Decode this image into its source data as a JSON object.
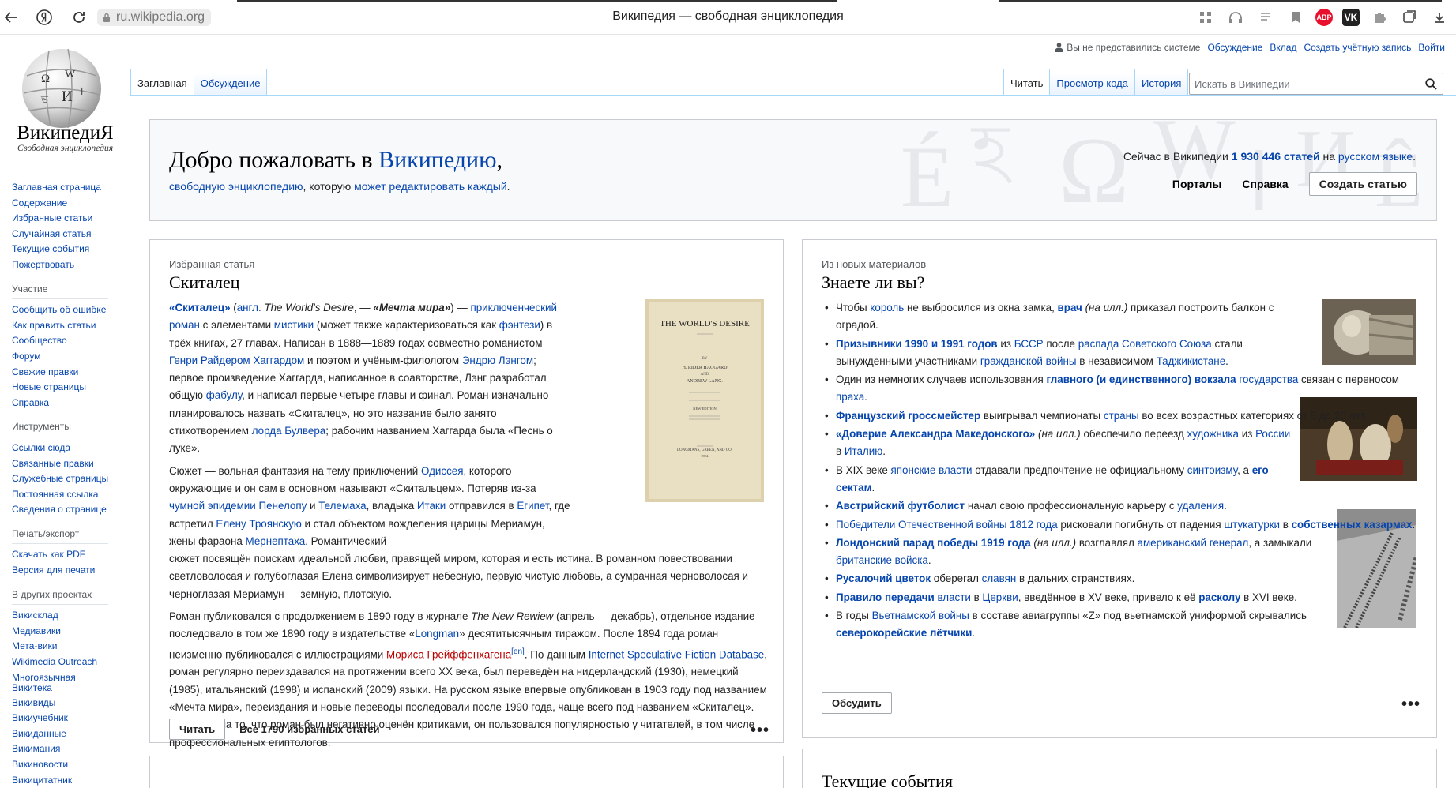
{
  "browser": {
    "url": "ru.wikipedia.org",
    "tab_title": "Википедия — свободная энциклопедия",
    "ext_abp": "ABP",
    "ext_vk": "VK"
  },
  "logo": {
    "wordmark": "ВикипедиЯ",
    "tagline": "Свободная энциклопедия"
  },
  "sidebar": {
    "main": [
      "Заглавная страница",
      "Содержание",
      "Избранные статьи",
      "Случайная статья",
      "Текущие события",
      "Пожертвовать"
    ],
    "participation_head": "Участие",
    "participation": [
      "Сообщить об ошибке",
      "Как править статьи",
      "Сообщество",
      "Форум",
      "Свежие правки",
      "Новые страницы",
      "Справка"
    ],
    "tools_head": "Инструменты",
    "tools": [
      "Ссылки сюда",
      "Связанные правки",
      "Служебные страницы",
      "Постоянная ссылка",
      "Сведения о странице"
    ],
    "print_head": "Печать/экспорт",
    "print": [
      "Скачать как PDF",
      "Версия для печати"
    ],
    "projects_head": "В других проектах",
    "projects": [
      "Викисклад",
      "Медиавики",
      "Мета-вики",
      "Wikimedia Outreach",
      "Многоязычная Викитека",
      "Викивиды",
      "Викиучебник",
      "Викиданные",
      "Викимания",
      "Викиновости",
      "Викицитатник"
    ]
  },
  "personal": {
    "anon": "Вы не представились системе",
    "talk": "Обсуждение",
    "contrib": "Вклад",
    "create_account": "Создать учётную запись",
    "login": "Войти"
  },
  "tabs": {
    "main": "Заглавная",
    "discussion": "Обсуждение",
    "read": "Читать",
    "view_source": "Просмотр кода",
    "history": "История"
  },
  "search": {
    "placeholder": "Искать в Википедии"
  },
  "welcome": {
    "title_prefix": "Добро пожаловать в ",
    "title_link": "Википедию",
    "title_suffix": ",",
    "sub_link1": "свободную энциклопедию",
    "sub_mid": ", которую ",
    "sub_link2": "может редактировать каждый",
    "sub_end": ".",
    "stat_prefix": "Сейчас в Википедии ",
    "stat_count": "1 930 446 статей",
    "stat_mid": " на ",
    "stat_lang": "русском языке",
    "stat_end": ".",
    "portals": "Порталы",
    "help": "Справка",
    "create": "Создать статью"
  },
  "featured": {
    "kicker": "Избранная статья",
    "title": "Скиталец",
    "read_btn": "Читать",
    "all_link": "Все 1790 избранных статей",
    "book": {
      "title": "THE WORLD'S DESIRE",
      "by": "BY",
      "author1": "H. RIDER HAGGARD",
      "and": "AND",
      "author2": "ANDREW LANG.",
      "edition": "NEW EDITION",
      "publisher": "LONGMANS, GREEN, AND CO.",
      "year": "1894."
    }
  },
  "dyk": {
    "kicker": "Из новых материалов",
    "title": "Знаете ли вы?",
    "discuss_btn": "Обсудить"
  },
  "news": {
    "title": "Текущие события"
  }
}
